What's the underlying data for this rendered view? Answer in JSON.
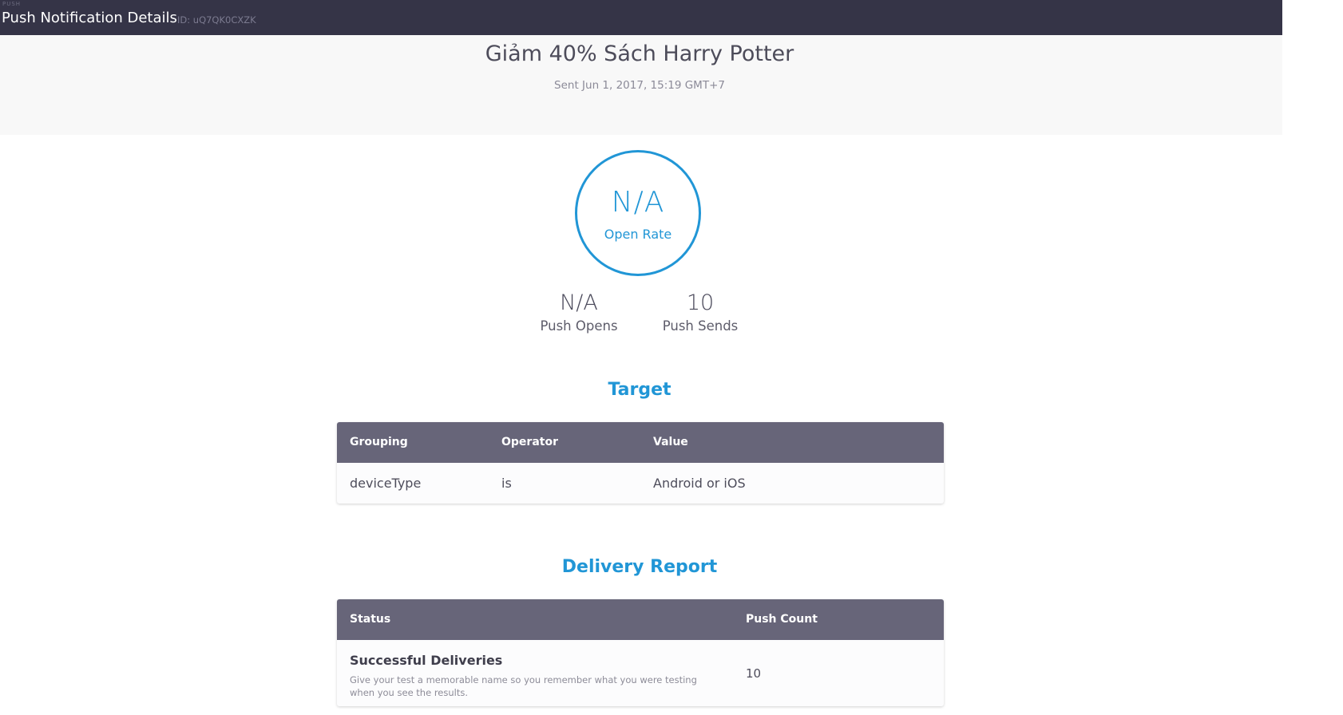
{
  "topbar": {
    "eyebrow": "PUSH",
    "title": "Push Notification Details",
    "id_text": "ID: uQ7QK0CXZK"
  },
  "campaign": {
    "title": "Giảm 40% Sách Harry Potter",
    "sent": "Sent Jun 1, 2017, 15:19 GMT+7"
  },
  "metrics": {
    "open_rate_value": "N/A",
    "open_rate_label": "Open Rate",
    "push_opens_value": "N/A",
    "push_opens_label": "Push Opens",
    "push_sends_value": "10",
    "push_sends_label": "Push Sends"
  },
  "target": {
    "heading": "Target",
    "columns": [
      "Grouping",
      "Operator",
      "Value"
    ],
    "rows": [
      [
        "deviceType",
        "is",
        "Android or iOS"
      ]
    ]
  },
  "delivery": {
    "heading": "Delivery Report",
    "columns": [
      "Status",
      "Push Count"
    ],
    "rows": [
      {
        "status": "Successful Deliveries",
        "description": "Give your test a memorable name so you remember what you were testing when you see the results.",
        "count": "10"
      }
    ]
  },
  "colors": {
    "topbar_bg": "#353447",
    "accent_blue": "#2196d6",
    "table_header_bg": "#676579"
  }
}
